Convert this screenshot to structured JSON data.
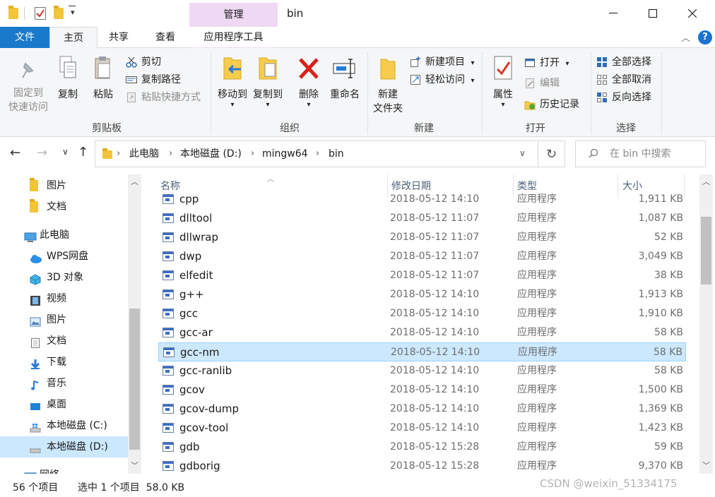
{
  "title": {
    "context_tab": "管理",
    "window_title": "bin"
  },
  "ribbon_tabs": {
    "file": "文件",
    "home": "主页",
    "share": "共享",
    "view": "查看",
    "app_tools": "应用程序工具"
  },
  "ribbon": {
    "clipboard": {
      "label": "剪贴板",
      "pin": "固定到\n快速访问",
      "pin_l1": "固定到",
      "pin_l2": "快速访问",
      "copy": "复制",
      "paste": "粘贴",
      "cut": "剪切",
      "copy_path": "复制路径",
      "paste_shortcut": "粘贴快捷方式"
    },
    "organize": {
      "label": "组织",
      "move_to": "移动到",
      "copy_to": "复制到",
      "delete": "删除",
      "rename": "重命名"
    },
    "new": {
      "label": "新建",
      "new_folder_l1": "新建",
      "new_folder_l2": "文件夹",
      "new_item": "新建项目",
      "easy_access": "轻松访问"
    },
    "open": {
      "label": "打开",
      "properties": "属性",
      "open": "打开",
      "edit": "编辑",
      "history": "历史记录"
    },
    "select": {
      "label": "选择",
      "select_all": "全部选择",
      "select_none": "全部取消",
      "invert": "反向选择"
    }
  },
  "address": {
    "crumbs": [
      "此电脑",
      "本地磁盘 (D:)",
      "mingw64",
      "bin"
    ],
    "search_placeholder": "在 bin 中搜索"
  },
  "nav": {
    "items": [
      "图片",
      "文档",
      "此电脑",
      "WPS网盘",
      "3D 对象",
      "视频",
      "图片",
      "文档",
      "下载",
      "音乐",
      "桌面",
      "本地磁盘 (C:)",
      "本地磁盘 (D:)",
      "网络"
    ]
  },
  "list": {
    "headers": {
      "name": "名称",
      "date": "修改日期",
      "type": "类型",
      "size": "大小"
    },
    "rows": [
      {
        "name": "cpp",
        "date": "2018-05-12 14:10",
        "type": "应用程序",
        "size": "1,911 KB"
      },
      {
        "name": "dlltool",
        "date": "2018-05-12 11:07",
        "type": "应用程序",
        "size": "1,087 KB"
      },
      {
        "name": "dllwrap",
        "date": "2018-05-12 11:07",
        "type": "应用程序",
        "size": "52 KB"
      },
      {
        "name": "dwp",
        "date": "2018-05-12 11:07",
        "type": "应用程序",
        "size": "3,049 KB"
      },
      {
        "name": "elfedit",
        "date": "2018-05-12 11:07",
        "type": "应用程序",
        "size": "38 KB"
      },
      {
        "name": "g++",
        "date": "2018-05-12 14:10",
        "type": "应用程序",
        "size": "1,913 KB"
      },
      {
        "name": "gcc",
        "date": "2018-05-12 14:10",
        "type": "应用程序",
        "size": "1,910 KB"
      },
      {
        "name": "gcc-ar",
        "date": "2018-05-12 14:10",
        "type": "应用程序",
        "size": "58 KB"
      },
      {
        "name": "gcc-nm",
        "date": "2018-05-12 14:10",
        "type": "应用程序",
        "size": "58 KB"
      },
      {
        "name": "gcc-ranlib",
        "date": "2018-05-12 14:10",
        "type": "应用程序",
        "size": "58 KB"
      },
      {
        "name": "gcov",
        "date": "2018-05-12 14:10",
        "type": "应用程序",
        "size": "1,500 KB"
      },
      {
        "name": "gcov-dump",
        "date": "2018-05-12 14:10",
        "type": "应用程序",
        "size": "1,369 KB"
      },
      {
        "name": "gcov-tool",
        "date": "2018-05-12 14:10",
        "type": "应用程序",
        "size": "1,423 KB"
      },
      {
        "name": "gdb",
        "date": "2018-05-12 15:28",
        "type": "应用程序",
        "size": "59 KB"
      },
      {
        "name": "gdborig",
        "date": "2018-05-12 15:28",
        "type": "应用程序",
        "size": "9,370 KB"
      }
    ],
    "selected_index": 8
  },
  "status": {
    "item_count": "56 个项目",
    "selection": "选中 1 个项目  58.0 KB"
  },
  "watermark": "CSDN @weixin_51334175",
  "colors": {
    "accent": "#1979ca",
    "selection": "#cce8ff",
    "context_tab": "#efd8f4"
  }
}
